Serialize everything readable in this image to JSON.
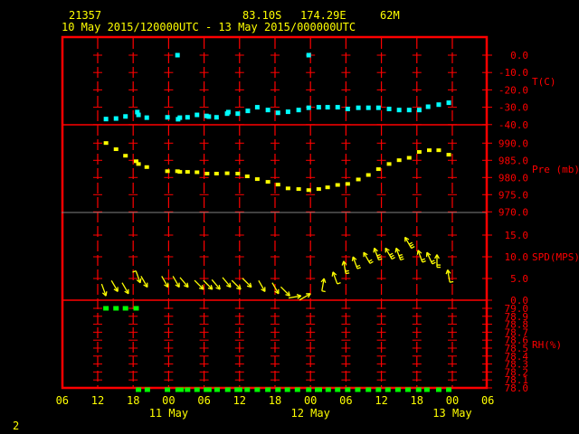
{
  "header": {
    "station_id": "21357",
    "latitude": "83.10S",
    "longitude": "174.29E",
    "elevation": "62M",
    "period": "10 May 2015/120000UTC - 13 May 2015/000000UTC"
  },
  "page_number": "2",
  "colors": {
    "frame": "#ff0000",
    "text": "#ffff00",
    "temperature": "#00ffff",
    "pressure": "#ffff00",
    "wind": "#ffff00",
    "rh": "#00ff00",
    "divider_gray": "#808080"
  },
  "chart_data": [
    {
      "type": "scatter",
      "title": "T(C)",
      "ylabel": "T(C)",
      "ylim": [
        -40,
        0
      ],
      "yticks": [
        "0.0",
        "-10.0",
        "-20.0",
        "-30.0",
        "-40.0"
      ],
      "ytick_values": [
        0,
        -10,
        -20,
        -30,
        -40
      ],
      "x_units": "hours since 10 May 2015 12:00 UTC",
      "x": [
        1.4,
        3.1,
        4.7,
        6.7,
        6.9,
        8.3,
        11.8,
        13.5,
        13.6,
        13.9,
        15.2,
        16.8,
        18.4,
        18.8,
        20.1,
        21.9,
        22.1,
        23.7,
        25.4,
        27,
        28.8,
        30.5,
        32.2,
        34,
        35.7,
        35.7,
        37.4,
        38.9,
        40.6,
        42.3,
        44.1,
        45.8,
        47.5,
        49.3,
        51,
        52.7,
        54.4,
        55.9,
        57.7,
        59.4
      ],
      "y": [
        -36.8,
        -36.5,
        -35.3,
        -32.8,
        -34.4,
        -36,
        -35.8,
        0,
        -36.9,
        -36,
        -35.8,
        -34.4,
        -35,
        -35.4,
        -35.8,
        -33.7,
        -32.8,
        -33.7,
        -32.1,
        -30,
        -31.6,
        -33.2,
        -32.6,
        -31.6,
        0,
        -30.3,
        -30,
        -30,
        -30,
        -31,
        -30.3,
        -30.3,
        -30.3,
        -31,
        -31.6,
        -31.6,
        -31.6,
        -29.7,
        -28.5,
        -27.4
      ]
    },
    {
      "type": "scatter",
      "title": "Pre (mb)",
      "ylabel": "Pre (mb)",
      "ylim": [
        970,
        990
      ],
      "yticks": [
        "990.0",
        "985.0",
        "980.0",
        "975.0",
        "970.0"
      ],
      "ytick_values": [
        990,
        985,
        980,
        975,
        970
      ],
      "x": [
        1.4,
        3.1,
        4.7,
        6.5,
        6.9,
        8.3,
        11.8,
        13.5,
        13.9,
        15.2,
        16.8,
        18.5,
        20.1,
        21.9,
        23.7,
        25.3,
        27,
        28.8,
        30.5,
        32.2,
        34,
        35.7,
        37.4,
        38.9,
        40.6,
        42.3,
        44.1,
        45.8,
        47.5,
        49.3,
        51,
        52.7,
        54.4,
        56.1,
        57.7,
        59.4
      ],
      "y": [
        989.9,
        988.1,
        986.2,
        984.6,
        983.8,
        982.9,
        981.7,
        981.7,
        981.5,
        981.5,
        981.4,
        981,
        981,
        981.1,
        981,
        980.2,
        979.4,
        978.6,
        977.8,
        976.7,
        976.5,
        976.2,
        976.5,
        977,
        977.7,
        978,
        979.3,
        980.6,
        982.3,
        983.8,
        984.9,
        985.6,
        987.3,
        987.8,
        987.8,
        986.5
      ]
    },
    {
      "type": "scatter",
      "title": "SPD(MPS)",
      "ylabel": "SPD(MPS)",
      "ylim": [
        0,
        15
      ],
      "yticks": [
        "15.0",
        "10.0",
        "5.0",
        "0.0"
      ],
      "ytick_values": [
        15,
        10,
        5,
        0
      ],
      "x": [
        1.4,
        3.4,
        5.2,
        7.2,
        8.4,
        11.9,
        13.8,
        15.3,
        17.9,
        19.4,
        20.7,
        22.5,
        24.2,
        26,
        28.3,
        30.6,
        32.5,
        34.4,
        36,
        38.3,
        39.8,
        41.6,
        43.2,
        45,
        46.8,
        48.7,
        50.5,
        52,
        54.2,
        55.7,
        57.4,
        59.2
      ],
      "y": [
        1,
        2,
        1.5,
        4,
        3,
        3,
        3,
        3,
        2.5,
        2.5,
        2.5,
        3,
        2.5,
        3,
        2,
        1.5,
        1,
        1,
        1.5,
        5,
        6.5,
        9,
        10,
        11,
        12,
        12,
        12,
        14.5,
        11.5,
        11,
        10.5,
        7
      ],
      "arrow_direction_deg": [
        160,
        150,
        150,
        160,
        150,
        150,
        150,
        140,
        135,
        135,
        140,
        140,
        135,
        135,
        150,
        150,
        135,
        80,
        60,
        10,
        340,
        350,
        340,
        330,
        340,
        330,
        340,
        330,
        340,
        335,
        0,
        350
      ]
    },
    {
      "type": "scatter",
      "title": "RH(%)",
      "ylabel": "RH(%)",
      "ylim": [
        78.0,
        79.0
      ],
      "yticks": [
        "79.0",
        "78.9",
        "78.8",
        "78.7",
        "78.6",
        "78.5",
        "78.4",
        "78.3",
        "78.2",
        "78.1",
        "78.0"
      ],
      "ytick_values": [
        79.0,
        78.9,
        78.8,
        78.7,
        78.6,
        78.5,
        78.4,
        78.3,
        78.2,
        78.1,
        78.0
      ],
      "x": [
        1.4,
        3.1,
        4.7,
        6.5,
        6.9,
        8.4,
        11.8,
        13.6,
        14.1,
        15.2,
        16.8,
        18.4,
        18.8,
        20.2,
        22,
        23.6,
        24,
        25.3,
        27,
        28.8,
        30.5,
        32.1,
        33.8,
        35.7,
        37.2,
        37.5,
        39,
        40.6,
        42.3,
        44,
        45.8,
        47.5,
        49.1,
        50.8,
        52.5,
        54.3,
        55.7,
        57.7,
        59.4
      ],
      "y": [
        79,
        79,
        79,
        79,
        78,
        78,
        78,
        78,
        78,
        78,
        78,
        78,
        78,
        78,
        78,
        78,
        78,
        78,
        78,
        78,
        78,
        78,
        78,
        78,
        78,
        78,
        78,
        78,
        78,
        78,
        78,
        78,
        78,
        78,
        78,
        78,
        78,
        78,
        78
      ]
    }
  ],
  "x_axis": {
    "tick_labels": [
      "06",
      "12",
      "18",
      "00",
      "06",
      "12",
      "18",
      "00",
      "06",
      "12",
      "18",
      "00",
      "06"
    ],
    "tick_hours": [
      -6,
      0,
      6,
      12,
      18,
      24,
      30,
      36,
      42,
      48,
      54,
      60,
      66
    ],
    "date_labels": [
      {
        "text": "11 May",
        "hour": 12
      },
      {
        "text": "12 May",
        "hour": 36
      },
      {
        "text": "13 May",
        "hour": 60
      }
    ]
  }
}
